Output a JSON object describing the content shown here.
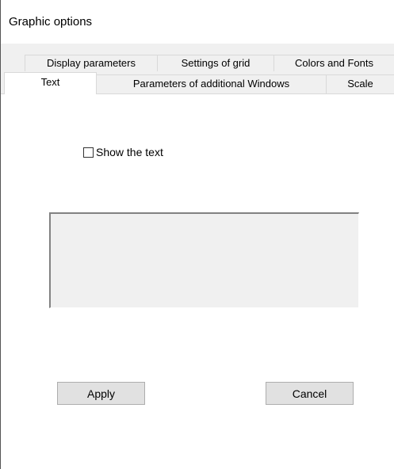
{
  "window": {
    "title": "Graphic options"
  },
  "tabs": {
    "row_back": [
      {
        "label": "Display parameters"
      },
      {
        "label": "Settings of grid"
      },
      {
        "label": "Colors and Fonts"
      }
    ],
    "row_front": [
      {
        "label": "Text",
        "selected": true
      },
      {
        "label": "Parameters of additional Windows"
      },
      {
        "label": "Scale"
      }
    ]
  },
  "panel": {
    "show_text_checkbox": {
      "label": "Show the text",
      "checked": false
    },
    "buttons": {
      "apply_label": "Apply",
      "cancel_label": "Cancel"
    }
  },
  "colors": {
    "window_bg": "#ffffff",
    "client_bg": "#f0f0f0",
    "button_bg": "#e1e1e1",
    "button_border": "#adadad"
  }
}
